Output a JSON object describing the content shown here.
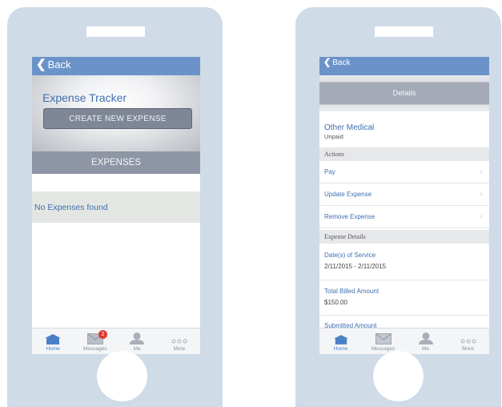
{
  "left": {
    "back_label": "Back",
    "title": "Expense Tracker",
    "create_button": "CREATE NEW EXPENSE",
    "expenses_header": "EXPENSES",
    "empty_message": "No Expenses found"
  },
  "right": {
    "back_label": "Back",
    "details_title": "Details",
    "record_title": "Other Medical",
    "record_status": "Unpaid",
    "actions_section": "Actions",
    "actions": [
      {
        "label": "Pay",
        "icon": "chevron-right-icon"
      },
      {
        "label": "Update Expense",
        "icon": "chevron-right-icon"
      },
      {
        "label": "Remove Expense",
        "icon": "chevron-right-icon"
      }
    ],
    "details_section": "Expense Details",
    "fields": [
      {
        "label": "Date(s) of Service",
        "value": "2/11/2015 - 2/11/2015"
      },
      {
        "label": "Total Billed Amount",
        "value": "$150.00"
      },
      {
        "label": "Submitted Amount",
        "value": ""
      }
    ]
  },
  "tabbar": {
    "tabs": [
      {
        "label": "Home",
        "icon": "home-icon",
        "active": true
      },
      {
        "label": "Messages",
        "icon": "envelope-icon",
        "badge": "2"
      },
      {
        "label": "Me",
        "icon": "person-icon"
      },
      {
        "label": "More",
        "icon": "more-dots-icon"
      }
    ]
  },
  "colors": {
    "navbar": "#6b93c9",
    "accent_text": "#3f6fb0",
    "phone_body": "#cfdbe6",
    "badge": "#e03a2f"
  }
}
